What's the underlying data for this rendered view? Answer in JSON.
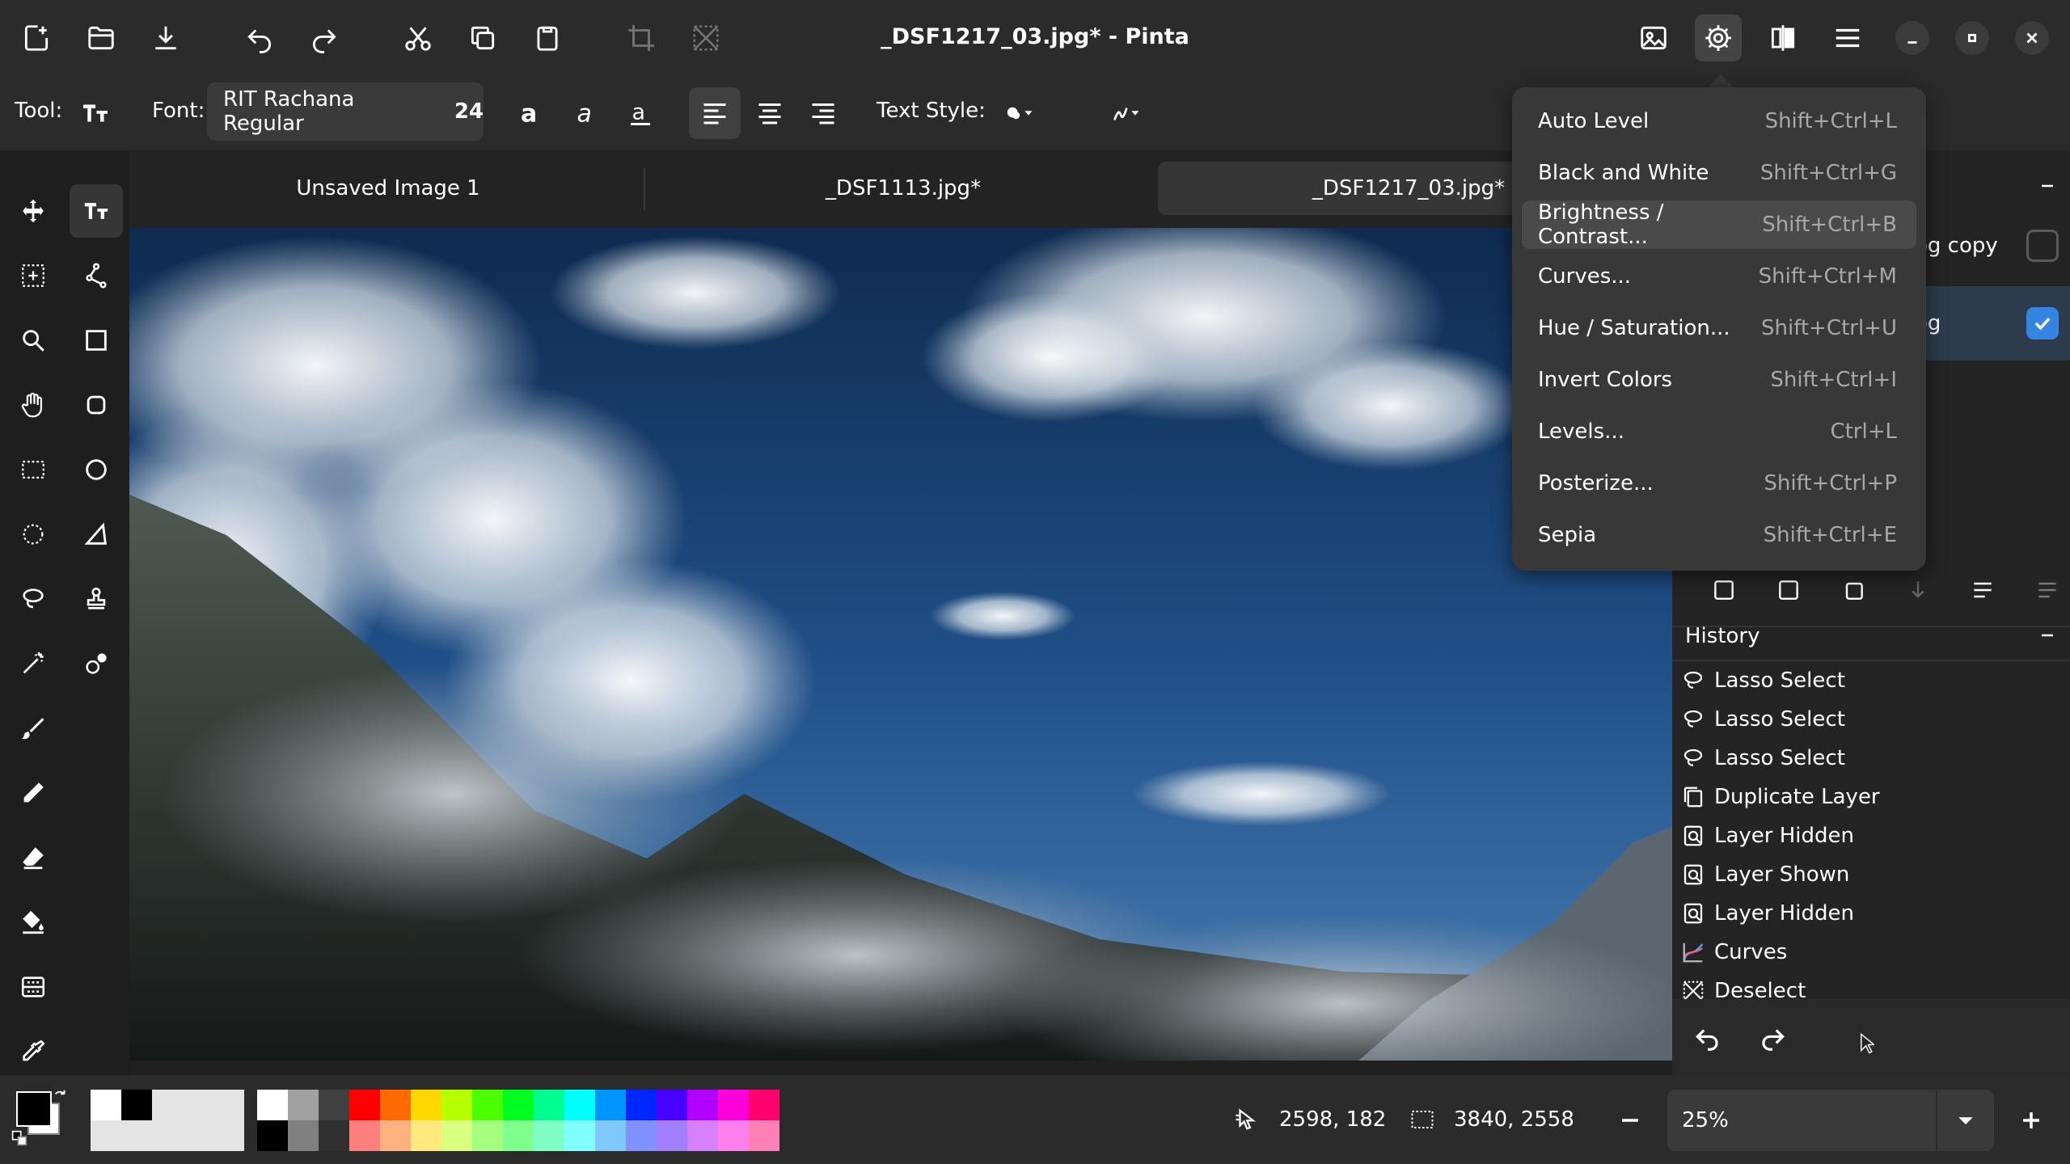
{
  "window": {
    "title": "_DSF1217_03.jpg* - Pinta"
  },
  "toolbar": {
    "tool_label": "Tool:",
    "font_label": "Font:",
    "font_name": "RIT Rachana Regular",
    "font_size": "24",
    "text_style_label": "Text Style:"
  },
  "tabs": [
    {
      "label": "Unsaved Image 1",
      "active": false
    },
    {
      "label": "_DSF1113.jpg*",
      "active": false
    },
    {
      "label": "_DSF1217_03.jpg*",
      "active": true
    }
  ],
  "layers": {
    "items": [
      {
        "label": "og copy",
        "visible": false
      },
      {
        "label": "og",
        "visible": true
      }
    ]
  },
  "history": {
    "title": "History",
    "items": [
      {
        "label": "Lasso Select",
        "icon": "lasso-icon"
      },
      {
        "label": "Lasso Select",
        "icon": "lasso-icon"
      },
      {
        "label": "Lasso Select",
        "icon": "lasso-icon"
      },
      {
        "label": "Duplicate Layer",
        "icon": "duplicate-layer-icon"
      },
      {
        "label": "Layer Hidden",
        "icon": "layer-properties-icon"
      },
      {
        "label": "Layer Shown",
        "icon": "layer-properties-icon"
      },
      {
        "label": "Layer Hidden",
        "icon": "layer-properties-icon"
      },
      {
        "label": "Curves",
        "icon": "curves-icon"
      },
      {
        "label": "Deselect",
        "icon": "deselect-icon"
      }
    ]
  },
  "adjustments_menu": {
    "items": [
      {
        "label": "Auto Level",
        "shortcut": "Shift+Ctrl+L"
      },
      {
        "label": "Black and White",
        "shortcut": "Shift+Ctrl+G"
      },
      {
        "label": "Brightness / Contrast...",
        "shortcut": "Shift+Ctrl+B",
        "hover": true
      },
      {
        "label": "Curves...",
        "shortcut": "Shift+Ctrl+M"
      },
      {
        "label": "Hue / Saturation...",
        "shortcut": "Shift+Ctrl+U"
      },
      {
        "label": "Invert Colors",
        "shortcut": "Shift+Ctrl+I"
      },
      {
        "label": "Levels...",
        "shortcut": "Ctrl+L"
      },
      {
        "label": "Posterize...",
        "shortcut": "Shift+Ctrl+P"
      },
      {
        "label": "Sepia",
        "shortcut": "Shift+Ctrl+E"
      }
    ]
  },
  "status": {
    "cursor_position": "2598, 182",
    "selection_size": "3840, 2558",
    "zoom": "25%"
  },
  "palette": {
    "primary_color": "#000000",
    "secondary_color": "#ffffff",
    "colors_top": [
      "#ffffff",
      "#a0a0a0",
      "#404040",
      "#ff0000",
      "#ff6a00",
      "#ffd800",
      "#b6ff00",
      "#4cff00",
      "#00ff21",
      "#00ff90",
      "#00ffff",
      "#0094ff",
      "#0026ff",
      "#4800ff",
      "#b200ff",
      "#ff00dc",
      "#ff006e"
    ],
    "colors_bottom": [
      "#000000",
      "#808080",
      "#303030",
      "#ff7f7f",
      "#ffb27f",
      "#ffe97f",
      "#daff7f",
      "#a5ff7f",
      "#7fff8e",
      "#7fffc5",
      "#7fffff",
      "#7fc9ff",
      "#7f92ff",
      "#a17fff",
      "#d67fff",
      "#ff7fed",
      "#ff7fb6"
    ]
  }
}
